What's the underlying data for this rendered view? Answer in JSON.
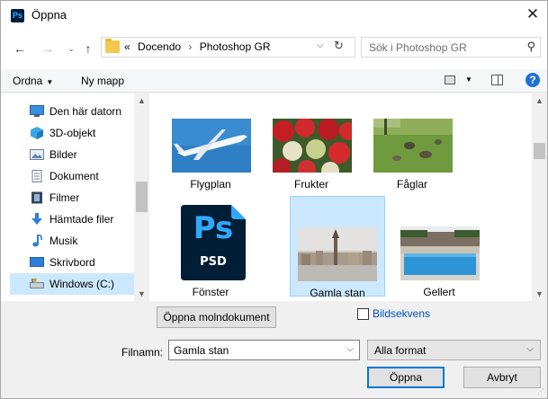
{
  "window": {
    "app_icon_text": "Ps",
    "title": "Öppna",
    "close_glyph": "✕"
  },
  "nav": {
    "back_glyph": "←",
    "forward_glyph": "→",
    "recent_glyph": "⌄",
    "up_glyph": "↑",
    "path_prefix": "«",
    "path": [
      "Docendo",
      "Photoshop GR"
    ],
    "path_separator": "›",
    "search_placeholder": "Sök i Photoshop GR"
  },
  "toolbar": {
    "organize_label": "Ordna",
    "new_folder_label": "Ny mapp",
    "help_label": "?"
  },
  "sidebar": {
    "items": [
      {
        "label": "Den här datorn",
        "icon": "computer-icon",
        "selected": false
      },
      {
        "label": "3D-objekt",
        "icon": "cube-icon",
        "selected": false
      },
      {
        "label": "Bilder",
        "icon": "pictures-icon",
        "selected": false
      },
      {
        "label": "Dokument",
        "icon": "document-icon",
        "selected": false
      },
      {
        "label": "Filmer",
        "icon": "film-icon",
        "selected": false
      },
      {
        "label": "Hämtade filer",
        "icon": "download-icon",
        "selected": false
      },
      {
        "label": "Musik",
        "icon": "music-icon",
        "selected": false
      },
      {
        "label": "Skrivbord",
        "icon": "desktop-icon",
        "selected": false
      },
      {
        "label": "Windows (C:)",
        "icon": "drive-icon",
        "selected": true
      }
    ]
  },
  "files": [
    {
      "name": "Flygplan",
      "thumb": "airplane",
      "selected": false
    },
    {
      "name": "Frukter",
      "thumb": "fruit",
      "selected": false
    },
    {
      "name": "Fåglar",
      "thumb": "birds",
      "selected": false
    },
    {
      "name": "Fönster",
      "thumb": "psd-file",
      "thumb_text": "Ps",
      "thumb_subtext": "PSD",
      "selected": false
    },
    {
      "name": "Gamla stan",
      "thumb": "city",
      "selected": true
    },
    {
      "name": "Gellert",
      "thumb": "pool",
      "selected": false
    }
  ],
  "actions": {
    "cloud_button": "Öppna molndokument",
    "image_sequence_label": "Bildsekvens",
    "image_sequence_checked": false,
    "filename_label": "Filnamn:",
    "filename_value": "Gamla stan",
    "format_value": "Alla format",
    "open_button": "Öppna",
    "cancel_button": "Avbryt"
  },
  "colors": {
    "selection": "#cce8ff",
    "accent": "#0078d7",
    "link": "#0050c0"
  }
}
